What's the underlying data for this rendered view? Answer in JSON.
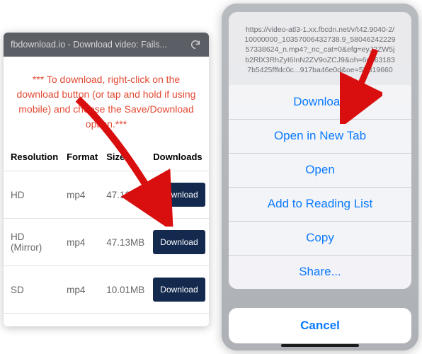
{
  "left": {
    "browser_title": "fbdownload.io - Download video: Fails...",
    "instructions": "*** To download, right-click on the download button (or tap and hold if using mobile) and choose the Save/Download option.***",
    "columns": {
      "resolution": "Resolution",
      "format": "Format",
      "size": "Size",
      "downloads": "Downloads"
    },
    "rows": [
      {
        "resolution": "HD",
        "format": "mp4",
        "size": "47.13MB",
        "button": "Download"
      },
      {
        "resolution": "HD (Mirror)",
        "format": "mp4",
        "size": "47.13MB",
        "button": "Download"
      },
      {
        "resolution": "SD",
        "format": "mp4",
        "size": "10.01MB",
        "button": "Download"
      }
    ]
  },
  "right": {
    "url_text": "https://video-atl3-1.xx.fbcdn.net/v/t42.9040-2/10000000_10357006432738.9_58046242229573386​24_n.mp4?_nc_cat=0&efg=eyJ2ZW5jb2RlX3RhZyI6InN2ZV9oZCJ9&oh=6ec631837b5425fffdc0c...917ba46e0d&oe=5B819660",
    "items": {
      "download": "Download",
      "new_tab": "Open in New Tab",
      "open": "Open",
      "reading_list": "Add to Reading List",
      "copy": "Copy",
      "share": "Share..."
    },
    "cancel": "Cancel"
  }
}
